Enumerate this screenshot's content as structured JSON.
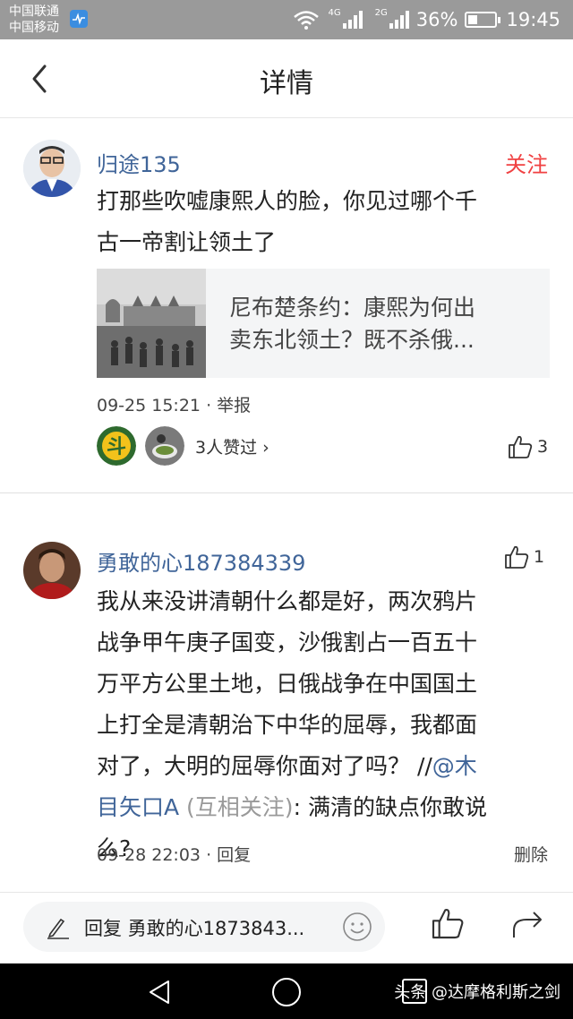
{
  "status_bar": {
    "carrier1": "中国联通",
    "carrier2": "中国移动",
    "net1": "4G",
    "net2": "2G",
    "battery": "36%",
    "battery_level": 0.36,
    "time": "19:45"
  },
  "header": {
    "title": "详情"
  },
  "comment1": {
    "username": "归途135",
    "follow_label": "关注",
    "text_line1": "打那些吹嘘康熙人的脸，你见过哪个千",
    "text_line2": "古一帝割让领土了",
    "article_title_line1": "尼布楚条约：康熙为何出",
    "article_title_line2": "卖东北领土？既不杀俄...",
    "timestamp": "09-25 15:21",
    "report": "· 举报",
    "likers_label": "3人赞过 ›",
    "like_count": "3"
  },
  "comment2": {
    "username": "勇敢的心187384339",
    "like_count": "1",
    "line1": "我从来没讲清朝什么都是好，两次鸦片",
    "line2": "战争甲午庚子国变，沙俄割占一百五十",
    "line3": "万平方公里土地，日俄战争在中国国土",
    "line4": "上打全是清朝治下中华的屈辱，我都面",
    "line5_prefix": "对了，大明的屈辱你面对了吗？ //",
    "line5_at": "@木",
    "line6_at": "目矢口A",
    "line6_mutual": " (互相关注)",
    "line6_rest": ": 满清的缺点你敢说",
    "line7": "么?",
    "timestamp": "09-28 22:03",
    "reply": "· 回复",
    "delete": "删除"
  },
  "bottom_bar": {
    "reply_placeholder": "回复 勇敢的心1873843..."
  },
  "nav_bar": {
    "watermark": "头条 @达摩格利斯之剑"
  }
}
